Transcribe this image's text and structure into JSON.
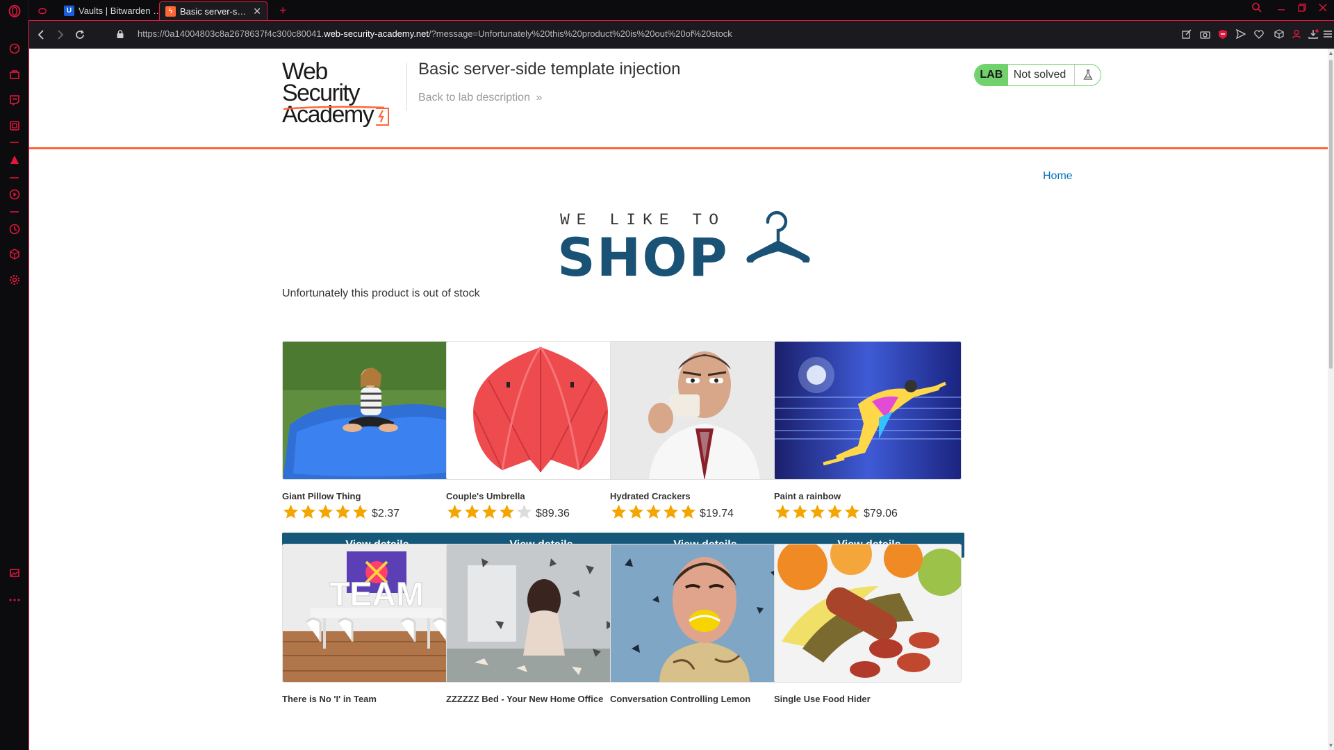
{
  "browser": {
    "tabs": [
      {
        "title": "Vaults | Bitwarden Web vault"
      },
      {
        "title": "Basic server-side template injection"
      }
    ],
    "url_prefix": "https://0a14004803c8a2678637f4c300c80041.",
    "url_host": "web-security-academy.net",
    "url_suffix": "/?message=Unfortunately%20this%20product%20is%20out%20of%20stock",
    "accent_color": "#e3173e"
  },
  "lab": {
    "logo_line1": "Web Security",
    "logo_line2": "Academy",
    "title": "Basic server-side template injection",
    "back_link": "Back to lab description",
    "badge": "LAB",
    "status": "Not solved"
  },
  "shop": {
    "nav_home": "Home",
    "tagline": "WE LIKE TO",
    "word": "SHOP",
    "message": "Unfortunately this product is out of stock",
    "button_label": "View details",
    "products": [
      {
        "name": "Giant Pillow Thing",
        "stars": 5,
        "price": "$2.37"
      },
      {
        "name": "Couple's Umbrella",
        "stars": 4,
        "price": "$89.36"
      },
      {
        "name": "Hydrated Crackers",
        "stars": 5,
        "price": "$19.74"
      },
      {
        "name": "Paint a rainbow",
        "stars": 5,
        "price": "$79.06"
      },
      {
        "name": "There is No 'I' in Team",
        "stars": 0,
        "price": ""
      },
      {
        "name": "ZZZZZZ Bed - Your New Home Office",
        "stars": 0,
        "price": ""
      },
      {
        "name": "Conversation Controlling Lemon",
        "stars": 0,
        "price": ""
      },
      {
        "name": "Single Use Food Hider",
        "stars": 0,
        "price": ""
      }
    ]
  }
}
